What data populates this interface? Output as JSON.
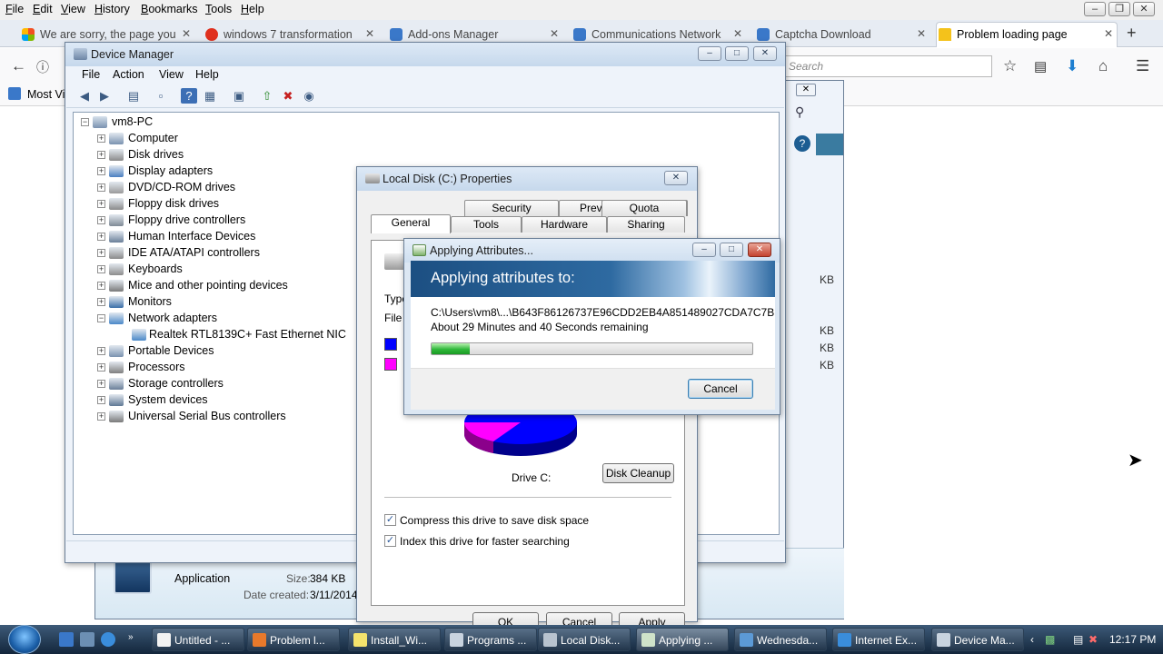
{
  "firefox": {
    "menus": [
      "File",
      "Edit",
      "View",
      "History",
      "Bookmarks",
      "Tools",
      "Help"
    ],
    "tabs": [
      {
        "label": "We are sorry, the page you",
        "color": "#f4b400"
      },
      {
        "label": "windows 7 transformation",
        "color": "#e0301e"
      },
      {
        "label": "Add-ons Manager",
        "color": "#3a78c9"
      },
      {
        "label": "Communications Network",
        "color": "#3a78c9"
      },
      {
        "label": "Captcha Download",
        "color": "#3a78c9"
      },
      {
        "label": "Problem loading page",
        "color": "#f4c21b"
      }
    ],
    "search_placeholder": "Search",
    "bookmarks_label": "Most Vi"
  },
  "background_window": {
    "file_type": "Application",
    "size_label": "Size:",
    "size_value": "384 KB",
    "date_label": "Date created:",
    "date_value": "3/11/2014",
    "kb_fragments": [
      "KB",
      "KB",
      "KB",
      "KB"
    ]
  },
  "device_manager": {
    "title": "Device Manager",
    "menus": [
      "File",
      "Action",
      "View",
      "Help"
    ],
    "root": "vm8-PC",
    "categories": [
      "Computer",
      "Disk drives",
      "Display adapters",
      "DVD/CD-ROM drives",
      "Floppy disk drives",
      "Floppy drive controllers",
      "Human Interface Devices",
      "IDE ATA/ATAPI controllers",
      "Keyboards",
      "Mice and other pointing devices",
      "Monitors",
      "Network adapters",
      "Portable Devices",
      "Processors",
      "Storage controllers",
      "System devices",
      "Universal Serial Bus controllers"
    ],
    "network_child": "Realtek RTL8139C+ Fast Ethernet NIC"
  },
  "properties": {
    "title": "Local Disk (C:) Properties",
    "tabs_row1": [
      "Security",
      "Previous Versions",
      "Quota"
    ],
    "tabs_row2": [
      "General",
      "Tools",
      "Hardware",
      "Sharing"
    ],
    "type_label": "Type",
    "fs_label": "File s",
    "used_color": "#0000ff",
    "free_color": "#ff00ff",
    "drive_label": "Drive C:",
    "disk_cleanup": "Disk Cleanup",
    "compress_label": "Compress this drive to save disk space",
    "index_label": "Index this drive for faster searching",
    "compress_checked": true,
    "index_checked": true,
    "ok": "OK",
    "cancel": "Cancel",
    "apply": "Apply"
  },
  "applying": {
    "title": "Applying Attributes...",
    "header": "Applying attributes to:",
    "path": "C:\\Users\\vm8\\...\\B643F86126737E96CDD2EB4A851489027CDA7C7B",
    "remaining": "About 29 Minutes and 40 Seconds remaining",
    "progress_fraction": 0.12,
    "cancel": "Cancel"
  },
  "taskbar": {
    "buttons": [
      {
        "label": "Untitled - ...",
        "color": "#f2f2f2"
      },
      {
        "label": "Problem l...",
        "color": "#e8792b"
      },
      {
        "label": "Install_Wi...",
        "color": "#f4e26c"
      },
      {
        "label": "Programs ...",
        "color": "#c8d3df"
      },
      {
        "label": "Local Disk...",
        "color": "#b8c3cf"
      },
      {
        "label": "Applying ...",
        "color": "#cfe3c9"
      },
      {
        "label": "Wednesda...",
        "color": "#5c9ad6"
      },
      {
        "label": "Internet Ex...",
        "color": "#3a8ddb"
      },
      {
        "label": "Device Ma...",
        "color": "#c8d3df"
      }
    ],
    "clock": "12:17 PM"
  }
}
